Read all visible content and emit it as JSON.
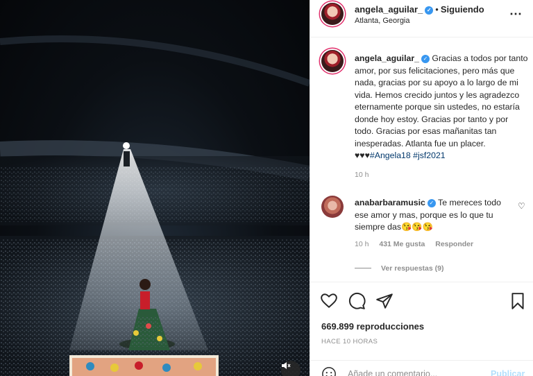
{
  "media": {
    "icon": "speaker-muted-icon"
  },
  "header": {
    "username": "angela_aguilar_",
    "dot": "•",
    "follow_status": "Siguiendo",
    "location": "Atlanta, Georgia",
    "more_icon": "more-options-icon"
  },
  "caption": {
    "username": "angela_aguilar_",
    "text": "Gracias a todos por tanto amor, por sus felicitaciones, pero más que nada, gracias por su apoyo a lo largo de mi vida. Hemos crecido juntos y les agradezco eternamente porque sin ustedes, no estaría donde hoy estoy. Gracias por tanto y por todo. Gracias por esas mañanitas tan inesperadas. Atlanta fue un placer. ♥♥♥",
    "tag1": "#Angela18",
    "tag2": "#jsf2021",
    "time": "10 h"
  },
  "comment": {
    "username": "anabarbaramusic",
    "text": "Te mereces todo ese amor y mas, porque es lo que tu siempre das😘😘😘",
    "time": "10 h",
    "likes": "431 Me gusta",
    "reply": "Responder",
    "view_replies": "Ver respuestas (9)"
  },
  "actions": {
    "views": "669.899 reproducciones",
    "ago": "HACE 10 HORAS"
  },
  "comment_box": {
    "placeholder": "Añade un comentario...",
    "publish": "Publicar"
  },
  "colors": {
    "verified": "#3897f0",
    "hashtag": "#00376b",
    "publish_disabled": "#b2dffc"
  }
}
